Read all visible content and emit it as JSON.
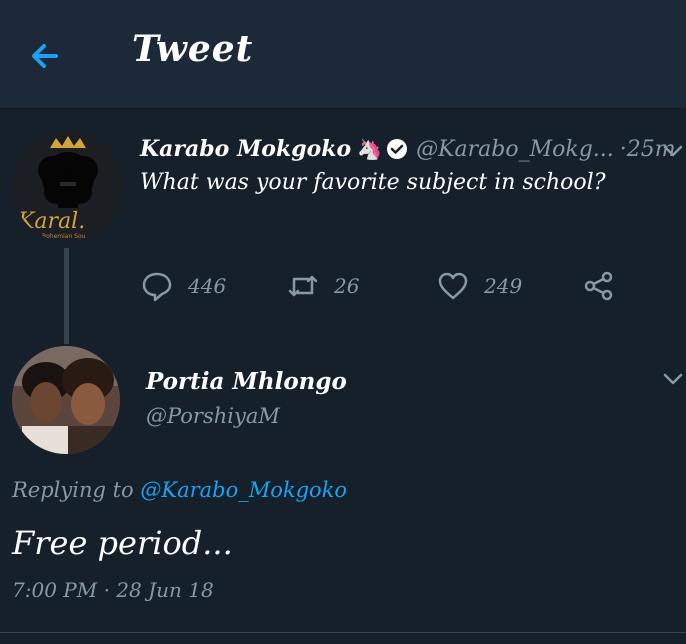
{
  "header": {
    "title": "Tweet",
    "back_icon": "arrow-left-icon",
    "accent": "#1da1f2"
  },
  "tweet": {
    "author_name": "Karabo Mokgoko",
    "badge_emoji": "🦄",
    "handle": "@Karabo_Mokg...",
    "time": "·25m",
    "text": "What was your favorite subject in school?",
    "avatar_text": "Karal.",
    "avatar_subtext": "Bohemian Sou",
    "actions": {
      "replies": "446",
      "retweets": "26",
      "likes": "249"
    }
  },
  "reply": {
    "author_name": "Portia Mhlongo",
    "handle": "@PorshiyaM",
    "replying_prefix": "Replying to ",
    "replying_to": "@Karabo_Mokgoko",
    "text": "Free period...",
    "timestamp": "7:00 PM · 28 Jun 18"
  },
  "colors": {
    "background": "#15202b",
    "header": "#1c2938",
    "secondary_text": "#8899a6",
    "divider": "#38444d"
  }
}
